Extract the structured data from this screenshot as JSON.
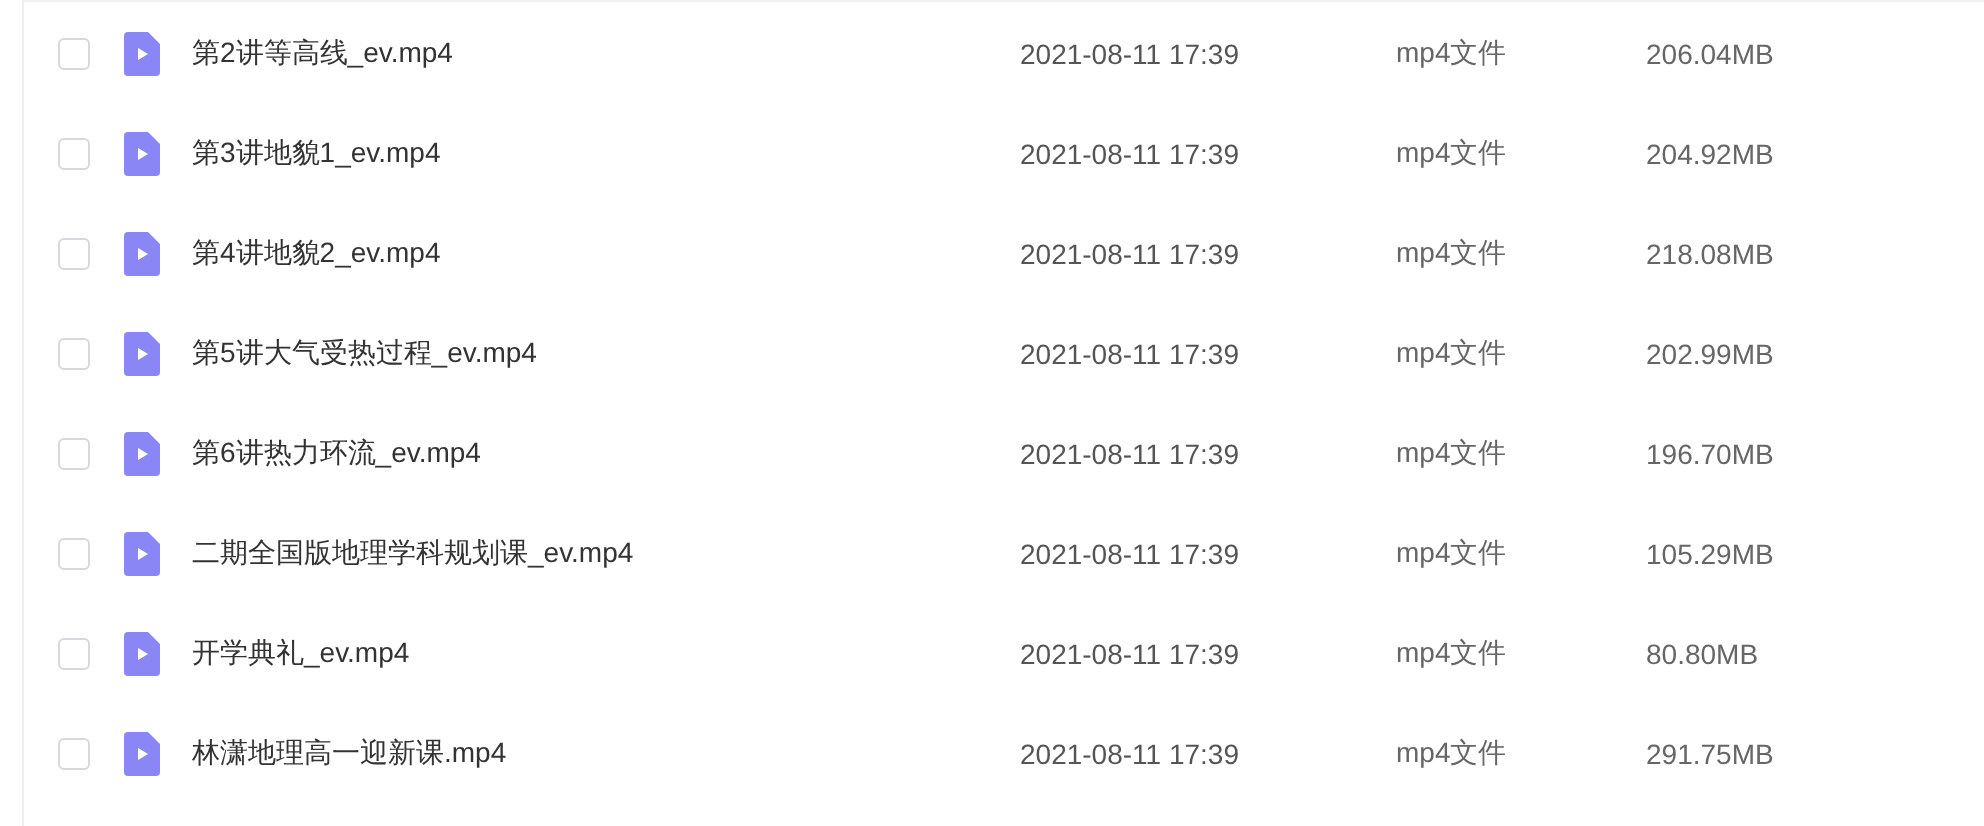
{
  "files": [
    {
      "name": "第2讲等高线_ev.mp4",
      "modified": "2021-08-11 17:39",
      "type": "mp4文件",
      "size": "206.04MB",
      "checked": false
    },
    {
      "name": "第3讲地貌1_ev.mp4",
      "modified": "2021-08-11 17:39",
      "type": "mp4文件",
      "size": "204.92MB",
      "checked": false
    },
    {
      "name": "第4讲地貌2_ev.mp4",
      "modified": "2021-08-11 17:39",
      "type": "mp4文件",
      "size": "218.08MB",
      "checked": false
    },
    {
      "name": "第5讲大气受热过程_ev.mp4",
      "modified": "2021-08-11 17:39",
      "type": "mp4文件",
      "size": "202.99MB",
      "checked": false
    },
    {
      "name": "第6讲热力环流_ev.mp4",
      "modified": "2021-08-11 17:39",
      "type": "mp4文件",
      "size": "196.70MB",
      "checked": false
    },
    {
      "name": "二期全国版地理学科规划课_ev.mp4",
      "modified": "2021-08-11 17:39",
      "type": "mp4文件",
      "size": "105.29MB",
      "checked": false
    },
    {
      "name": "开学典礼_ev.mp4",
      "modified": "2021-08-11 17:39",
      "type": "mp4文件",
      "size": "80.80MB",
      "checked": false
    },
    {
      "name": "林潇地理高一迎新课.mp4",
      "modified": "2021-08-11 17:39",
      "type": "mp4文件",
      "size": "291.75MB",
      "checked": false
    }
  ]
}
